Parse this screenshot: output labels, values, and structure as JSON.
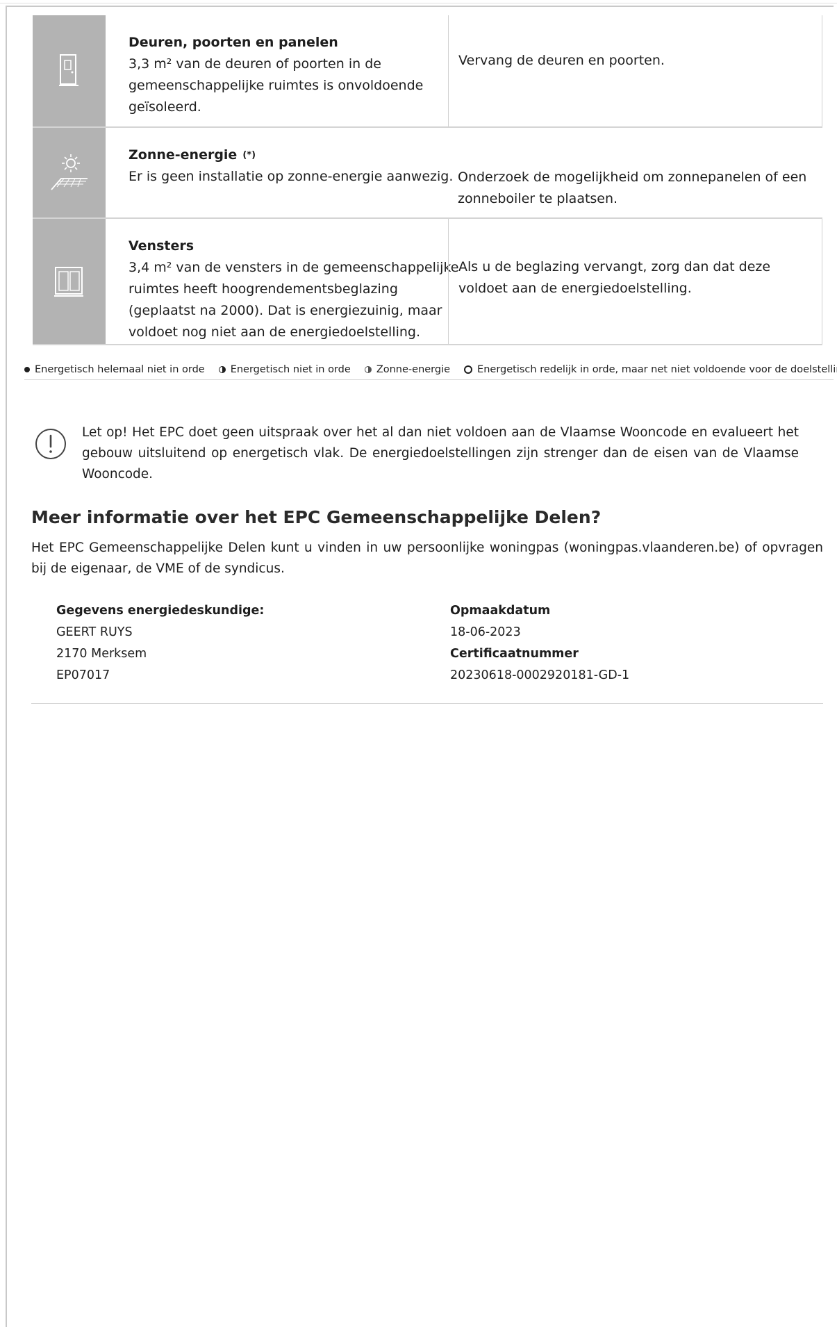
{
  "measures": [
    {
      "icon": "door-icon",
      "title": "Deuren, poorten en panelen",
      "current_lines": [
        "3,3 m² van de deuren of poorten in de",
        "gemeenschappelijke ruimtes is onvoldoende",
        "geïsoleerd."
      ],
      "advice": "Vervang de deuren en poorten."
    },
    {
      "icon": "sun-roof-icon",
      "title": "Zonne-energie",
      "title_mark": "(*)",
      "current_lines": [
        "Er is geen installatie op zonne-energie aanwezig."
      ],
      "advice_lines": [
        "Onderzoek de mogelijkheid om zonnepanelen of een",
        "zonneboiler te plaatsen."
      ]
    },
    {
      "icon": "window-icon",
      "title": "Vensters",
      "current_lines": [
        "3,4 m² van de vensters in de gemeenschappelijke",
        "ruimtes heeft hoogrendementsbeglazing",
        "(geplaatst na 2000). Dat is energiezuinig, maar",
        "voldoet nog niet aan de energiedoelstelling."
      ],
      "advice_lines": [
        "Als u de beglazing vervangt, zorg dan dat deze",
        "voldoet aan de energiedoelstelling."
      ]
    }
  ],
  "legend": [
    "Energetisch helemaal niet in orde",
    "Energetisch niet in orde",
    "Zonne-energie",
    "Energetisch redelijk in orde, maar net niet voldoende voor de doelstelling"
  ],
  "notice": {
    "icon": "exclamation-circle-icon",
    "text": "Let op! Het EPC doet geen uitspraak over het al dan niet voldoen aan de Vlaamse Wooncode en evalueert het gebouw uitsluitend op energetisch vlak. De energiedoelstellingen zijn strenger dan de eisen van de Vlaamse Wooncode."
  },
  "more_info": {
    "heading": "Meer informatie over het EPC Gemeenschappelijke Delen?",
    "text": "Het EPC Gemeenschappelijke Delen kunt u vinden in uw persoonlijke woningpas (woningpas.vlaanderen.be) of opvragen bij de eigenaar, de VME of de syndicus."
  },
  "expert": {
    "label": "Gegevens energiedeskundige:",
    "name": "GEERT RUYS",
    "city": "2170 Merksem",
    "id": "EP07017"
  },
  "certificate": {
    "date_label": "Opmaakdatum",
    "date": "18-06-2023",
    "number_label": "Certificaatnummer",
    "number": "20230618-0002920181-GD-1"
  },
  "colors": {
    "icon_bg": "#b3b3b3",
    "border": "#d4d4d4",
    "text": "#1e1e1e"
  }
}
